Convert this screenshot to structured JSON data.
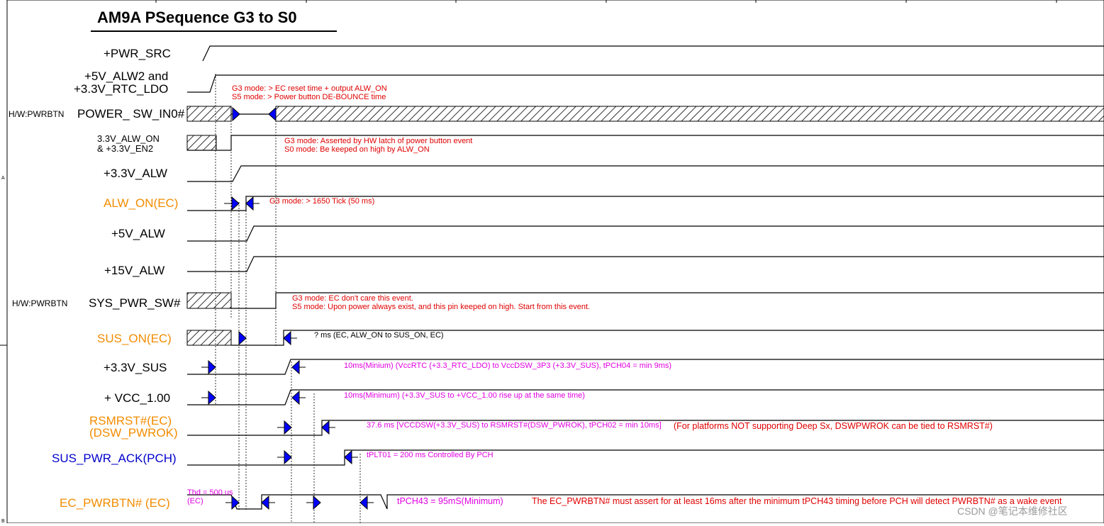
{
  "title": "AM9A PSequence G3 to S0",
  "signals": [
    {
      "id": "pwr_src",
      "lines": [
        "+PWR_SRC"
      ],
      "kind": "normal"
    },
    {
      "id": "alw2",
      "lines": [
        "+5V_ALW2 and",
        "+3.3V_RTC_LDO"
      ],
      "kind": "normal"
    },
    {
      "id": "power_sw",
      "lines": [
        "POWER_ SW_IN0#"
      ],
      "kind": "normal",
      "tag": "H/W:PWRBTN"
    },
    {
      "id": "alw_on_en2",
      "lines": [
        "3.3V_ALW_ON",
        "& +3.3V_EN2"
      ],
      "kind": "small"
    },
    {
      "id": "v33_alw",
      "lines": [
        "+3.3V_ALW"
      ],
      "kind": "normal"
    },
    {
      "id": "alw_on_ec",
      "lines": [
        "ALW_ON(EC)"
      ],
      "kind": "ec"
    },
    {
      "id": "v5_alw",
      "lines": [
        "+5V_ALW"
      ],
      "kind": "normal"
    },
    {
      "id": "v15_alw",
      "lines": [
        "+15V_ALW"
      ],
      "kind": "normal"
    },
    {
      "id": "sys_pwr",
      "lines": [
        "SYS_PWR_SW#"
      ],
      "kind": "normal",
      "tag": "H/W:PWRBTN"
    },
    {
      "id": "sus_on",
      "lines": [
        "SUS_ON(EC)"
      ],
      "kind": "ec"
    },
    {
      "id": "v33_sus",
      "lines": [
        "+3.3V_SUS"
      ],
      "kind": "normal"
    },
    {
      "id": "vcc100",
      "lines": [
        "+ VCC_1.00"
      ],
      "kind": "normal"
    },
    {
      "id": "rsmrst",
      "lines": [
        "RSMRST#(EC)",
        "(DSW_PWROK)"
      ],
      "kind": "ec"
    },
    {
      "id": "sus_pwr_ack",
      "lines": [
        "SUS_PWR_ACK(PCH)"
      ],
      "kind": "pch"
    },
    {
      "id": "ec_pwrbtn",
      "lines": [
        "EC_PWRBTN# (EC)"
      ],
      "kind": "ec"
    }
  ],
  "notes": {
    "n1": "G3 mode: > EC reset time + output ALW_ON",
    "n2": "S5 mode: > Power button DE-BOUNCE time",
    "n3": "G3 mode: Asserted by HW latch of power button event",
    "n4": "S0 mode: Be keeped on high by ALW_ON",
    "n5": "G3 mode: > 1650 Tick (50 ms)",
    "n6": "G3 mode: EC don't care this event.",
    "n7": "S5 mode: Upon power always exist, and this pin keeped on high. Start from this event.",
    "n8": "? ms (EC, ALW_ON to SUS_ON, EC)",
    "n9": "10ms(Minium) (VccRTC (+3.3_RTC_LDO) to VccDSW_3P3 (+3.3V_SUS), tPCH04 = min 9ms)",
    "n10": "10ms(Minimum) (+3.3V_SUS to +VCC_1.00 rise up at the same time)",
    "n11": "37.6 ms [VCCDSW(+3.3V_SUS) to RSMRST#(DSW_PWROK), tPCH02 = min 10ms]",
    "n12": "(For platforms NOT supporting Deep Sx, DSWPWROK can be tied to RSMRST#)",
    "n13": "tPLT01 = 200 ms Controlled By PCH",
    "n14": "Thd = 500 us",
    "n15": "(EC)",
    "n16": "tPCH43 = 95mS(Minimum)",
    "n17": "The EC_PWRBTN# must assert for at least 16ms after the minimum tPCH43 timing before PCH will detect PWRBTN# as a wake event"
  },
  "margin_marks": {
    "a": "A",
    "b": "B"
  },
  "watermark": "CSDN @笔记本维修社区",
  "colors": {
    "signal": "#000000",
    "ec": "#f28c00",
    "pch": "#0000cc",
    "note_red": "#e00000",
    "note_magenta": "#e000e0",
    "arrow": "#0000ff"
  }
}
